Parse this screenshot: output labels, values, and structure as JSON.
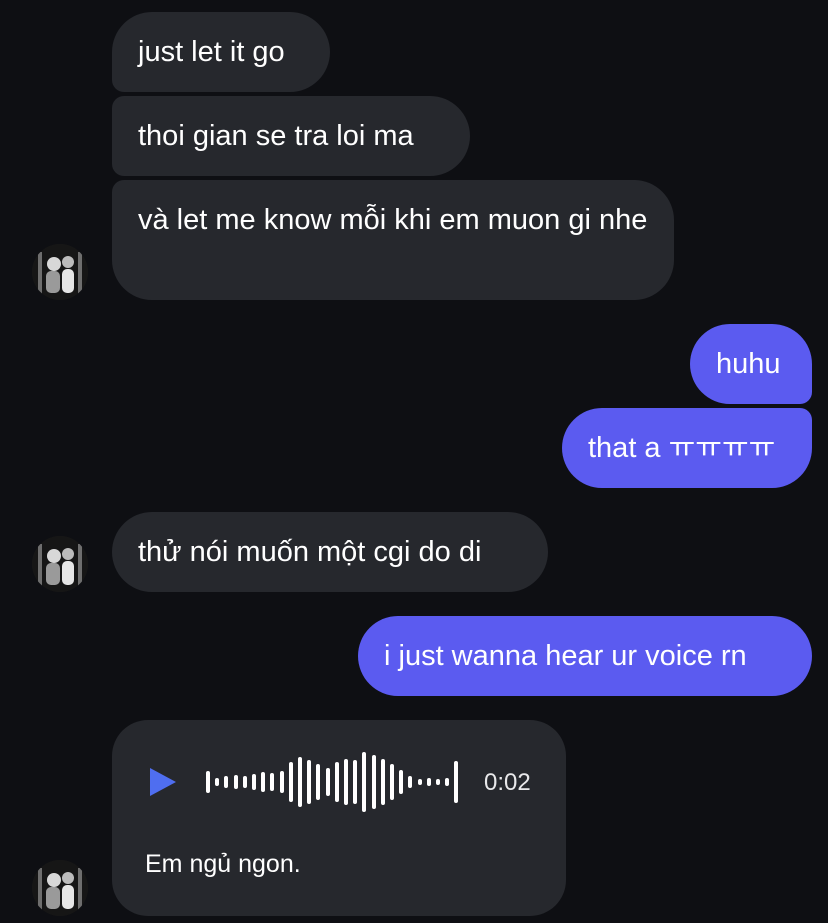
{
  "messages": [
    {
      "side": "incoming",
      "text": "just let it go"
    },
    {
      "side": "incoming",
      "text": "thoi gian se tra loi ma"
    },
    {
      "side": "incoming",
      "text": "và let me know mỗi khi em muon gi nhe"
    },
    {
      "side": "outgoing",
      "text": "huhu"
    },
    {
      "side": "outgoing",
      "text": "that a ㅠㅠㅠㅠ"
    },
    {
      "side": "incoming",
      "text": "thử nói muốn một cgi do di"
    },
    {
      "side": "outgoing",
      "text": "i just wanna hear ur voice rn"
    }
  ],
  "voice_message": {
    "duration": "0:02",
    "transcript": "Em ngủ ngon.",
    "play_icon": "play-icon"
  },
  "colors": {
    "background": "#0e0f13",
    "incoming_bubble": "#26282d",
    "outgoing_bubble": "#5b5bf0",
    "play_icon": "#4f6ef0"
  }
}
